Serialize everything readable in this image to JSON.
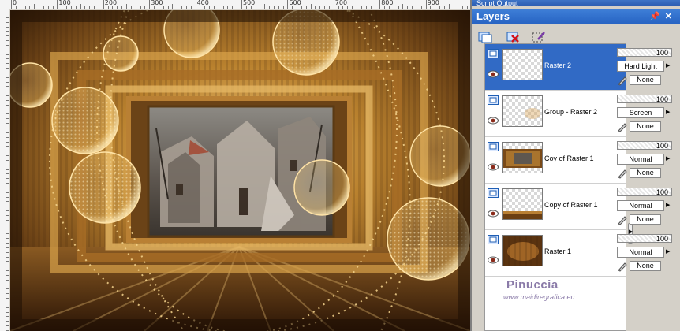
{
  "window": {
    "script_output_title": "Script Output",
    "layers_title": "Layers"
  },
  "ruler": {
    "top_labels": [
      "0",
      "100",
      "200",
      "300",
      "400",
      "500",
      "600",
      "700",
      "800",
      "900"
    ]
  },
  "toolbar": {
    "icons": [
      "new-layer-icon",
      "delete-layer-icon",
      "edit-selection-icon"
    ]
  },
  "layers": [
    {
      "name": "Raster 2",
      "selected": true,
      "opacity": "100",
      "blend": "Hard Light",
      "lock": "None",
      "thumb": "transparent"
    },
    {
      "name": "Group - Raster 2",
      "selected": false,
      "opacity": "100",
      "blend": "Screen",
      "lock": "None",
      "thumb": "faint-brown"
    },
    {
      "name": "Coy of Raster 1",
      "selected": false,
      "opacity": "100",
      "blend": "Normal",
      "lock": "None",
      "thumb": "framed-image"
    },
    {
      "name": "Copy of Raster 1",
      "selected": false,
      "opacity": "100",
      "blend": "Normal",
      "lock": "None",
      "thumb": "bottom-strip"
    },
    {
      "name": "Raster 1",
      "selected": false,
      "opacity": "100",
      "blend": "Normal",
      "lock": "None",
      "thumb": "brown-texture"
    }
  ],
  "watermark": {
    "brand": "Pinuccia",
    "site": "www.maidiregrafica.eu"
  },
  "colors": {
    "title_blue": "#2a64c2",
    "selection_blue": "#316ac5",
    "panel_gray": "#d4d0c8",
    "gold": "#c8962e",
    "dark_brown": "#3a2410"
  }
}
